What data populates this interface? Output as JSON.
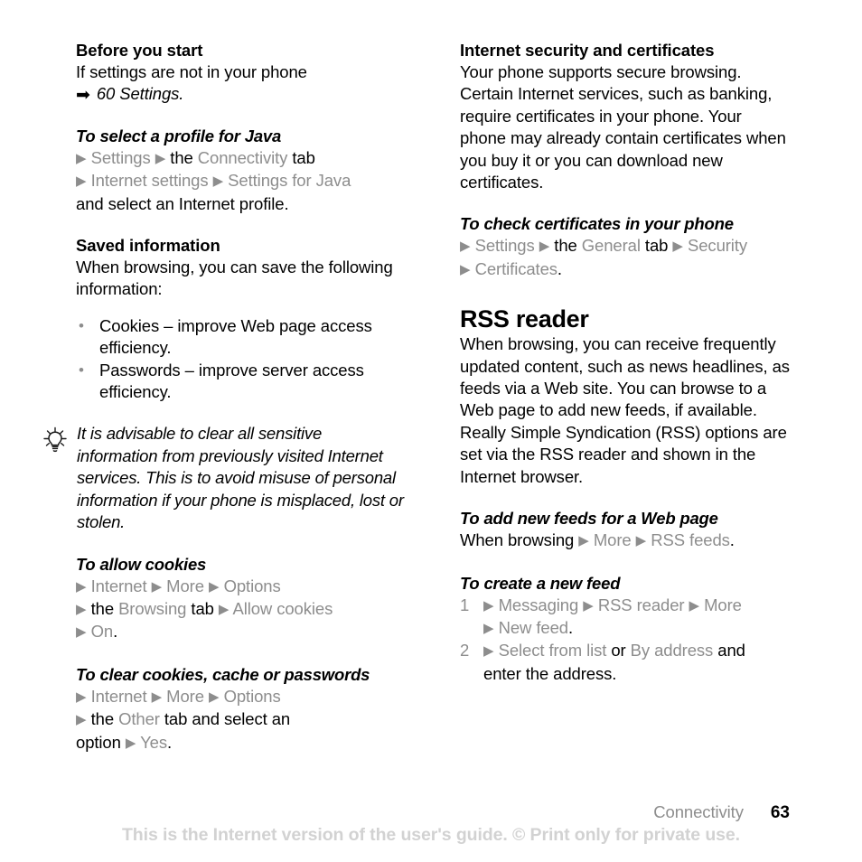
{
  "document": {
    "type": "user-guide-page",
    "page_number": "63",
    "chapter": "Connectivity",
    "watermark": "This is the Internet version of the user's guide. © Print only for private use.",
    "colors": {
      "text": "#000000",
      "menu_path": "#8d8d8d",
      "watermark": "#d2d2d2"
    }
  },
  "left_column": {
    "before_you_start": {
      "heading": "Before you start",
      "body": "If settings are not in your phone",
      "xref_arrow": "➡",
      "xref_text": "60 Settings."
    },
    "select_profile": {
      "heading": "To select a profile for Java",
      "line1": [
        {
          "t": "▶",
          "k": "tri"
        },
        {
          "t": "Settings",
          "k": "menu"
        },
        {
          "t": "▶",
          "k": "tri"
        },
        {
          "t": "the",
          "k": "plain"
        },
        {
          "t": "Connectivity",
          "k": "menu"
        },
        {
          "t": "tab",
          "k": "plain"
        }
      ],
      "line2": [
        {
          "t": "▶",
          "k": "tri"
        },
        {
          "t": "Internet settings",
          "k": "menu"
        },
        {
          "t": "▶",
          "k": "tri"
        },
        {
          "t": "Settings for Java",
          "k": "menu"
        }
      ],
      "line3": [
        {
          "t": "and select an Internet profile.",
          "k": "plain"
        }
      ]
    },
    "saved_information": {
      "heading": "Saved information",
      "body": "When browsing, you can save the following information:",
      "bullets": [
        "Cookies – improve Web page access efficiency.",
        "Passwords – improve server access efficiency."
      ]
    },
    "tip": {
      "icon": "lightbulb-icon",
      "text": "It is advisable to clear all sensitive information from previously visited Internet services. This is to avoid misuse of personal information if your phone is misplaced, lost or stolen."
    },
    "allow_cookies": {
      "heading": "To allow cookies",
      "line1": [
        {
          "t": "▶",
          "k": "tri"
        },
        {
          "t": "Internet",
          "k": "menu"
        },
        {
          "t": "▶",
          "k": "tri"
        },
        {
          "t": "More",
          "k": "menu"
        },
        {
          "t": "▶",
          "k": "tri"
        },
        {
          "t": "Options",
          "k": "menu"
        }
      ],
      "line2": [
        {
          "t": "▶",
          "k": "tri"
        },
        {
          "t": "the",
          "k": "plain"
        },
        {
          "t": "Browsing",
          "k": "menu"
        },
        {
          "t": "tab",
          "k": "plain"
        },
        {
          "t": "▶",
          "k": "tri"
        },
        {
          "t": "Allow cookies",
          "k": "menu"
        }
      ],
      "line3": [
        {
          "t": "▶",
          "k": "tri"
        },
        {
          "t": "On",
          "k": "menu"
        },
        {
          "t": ".",
          "k": "plain"
        }
      ]
    },
    "clear_cookies": {
      "heading": "To clear cookies, cache or passwords",
      "line1": [
        {
          "t": "▶",
          "k": "tri"
        },
        {
          "t": "Internet",
          "k": "menu"
        },
        {
          "t": "▶",
          "k": "tri"
        },
        {
          "t": "More",
          "k": "menu"
        },
        {
          "t": "▶",
          "k": "tri"
        },
        {
          "t": "Options",
          "k": "menu"
        }
      ],
      "line2": [
        {
          "t": "▶",
          "k": "tri"
        },
        {
          "t": "the",
          "k": "plain"
        },
        {
          "t": "Other",
          "k": "menu"
        },
        {
          "t": "tab and select an",
          "k": "plain"
        }
      ],
      "line3": [
        {
          "t": "option",
          "k": "plain"
        },
        {
          "t": "▶",
          "k": "tri"
        },
        {
          "t": "Yes",
          "k": "menu"
        },
        {
          "t": ".",
          "k": "plain"
        }
      ]
    }
  },
  "right_column": {
    "internet_security": {
      "heading": "Internet security and certificates",
      "body": "Your phone supports secure browsing. Certain Internet services, such as banking, require certificates in your phone. Your phone may already contain certificates when you buy it or you can download new certificates."
    },
    "check_certificates": {
      "heading": "To check certificates in your phone",
      "line1": [
        {
          "t": "▶",
          "k": "tri"
        },
        {
          "t": "Settings",
          "k": "menu"
        },
        {
          "t": "▶",
          "k": "tri"
        },
        {
          "t": "the",
          "k": "plain"
        },
        {
          "t": "General",
          "k": "menu"
        },
        {
          "t": "tab",
          "k": "plain"
        },
        {
          "t": "▶",
          "k": "tri"
        },
        {
          "t": "Security",
          "k": "menu"
        }
      ],
      "line2": [
        {
          "t": "▶",
          "k": "tri"
        },
        {
          "t": "Certificates",
          "k": "menu"
        },
        {
          "t": ".",
          "k": "plain"
        }
      ]
    },
    "rss_reader": {
      "heading": "RSS reader",
      "body": "When browsing, you can receive frequently updated content, such as news headlines, as feeds via a Web site. You can browse to a Web page to add new feeds, if available. Really Simple Syndication (RSS) options are set via the RSS reader and shown in the Internet browser."
    },
    "add_feeds": {
      "heading": "To add new feeds for a Web page",
      "line1": [
        {
          "t": "When browsing",
          "k": "plain"
        },
        {
          "t": "▶",
          "k": "tri"
        },
        {
          "t": "More",
          "k": "menu"
        },
        {
          "t": "▶",
          "k": "tri"
        },
        {
          "t": "RSS feeds",
          "k": "menu"
        },
        {
          "t": ".",
          "k": "plain"
        }
      ]
    },
    "create_feed": {
      "heading": "To create a new feed",
      "steps": [
        {
          "num": "1",
          "lines": [
            [
              {
                "t": "▶",
                "k": "tri"
              },
              {
                "t": "Messaging",
                "k": "menu"
              },
              {
                "t": "▶",
                "k": "tri"
              },
              {
                "t": "RSS reader",
                "k": "menu"
              },
              {
                "t": "▶",
                "k": "tri"
              },
              {
                "t": "More",
                "k": "menu"
              }
            ],
            [
              {
                "t": "▶",
                "k": "tri"
              },
              {
                "t": "New feed",
                "k": "menu"
              },
              {
                "t": ".",
                "k": "plain"
              }
            ]
          ]
        },
        {
          "num": "2",
          "lines": [
            [
              {
                "t": "▶",
                "k": "tri"
              },
              {
                "t": "Select from list",
                "k": "menu"
              },
              {
                "t": "or",
                "k": "plain"
              },
              {
                "t": "By address",
                "k": "menu"
              },
              {
                "t": "and",
                "k": "plain"
              }
            ],
            [
              {
                "t": "enter the address.",
                "k": "plain"
              }
            ]
          ]
        }
      ]
    }
  }
}
